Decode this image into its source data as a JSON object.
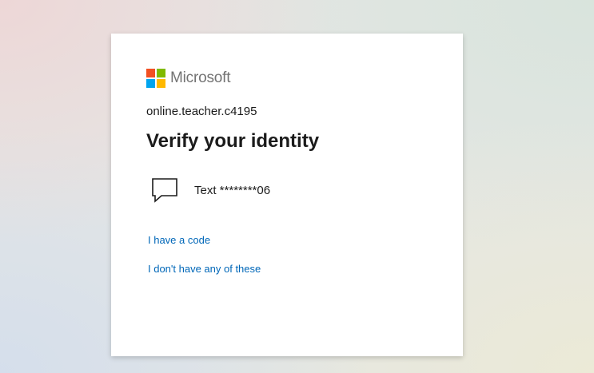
{
  "brand": {
    "name": "Microsoft",
    "logo_colors": [
      "#f25022",
      "#7fba00",
      "#00a4ef",
      "#ffb900"
    ]
  },
  "account": {
    "username": "online.teacher.c4195"
  },
  "heading": {
    "title": "Verify your identity"
  },
  "options": [
    {
      "icon": "chat-bubble-icon",
      "label": "Text ********06"
    }
  ],
  "links": {
    "have_code": "I have a code",
    "none_of_these": "I don't have any of these"
  },
  "colors": {
    "link": "#0067b8",
    "text": "#1b1b1b",
    "brand_text": "#737373"
  }
}
